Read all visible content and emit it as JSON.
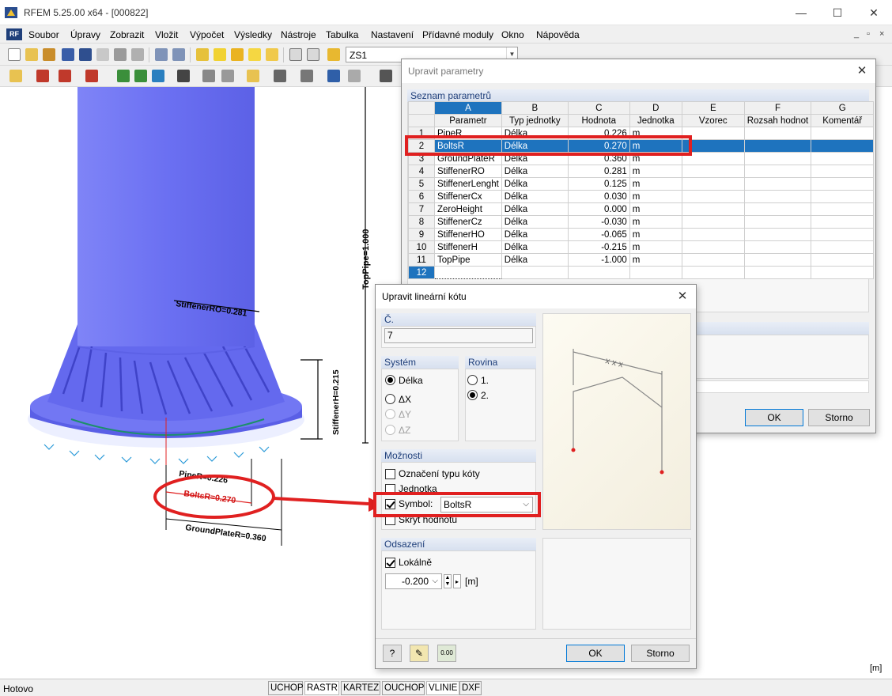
{
  "window": {
    "title": "RFEM 5.25.00 x64 - [000822]",
    "minimize": "—",
    "maximize": "☐",
    "close": "✕"
  },
  "menu": {
    "items": [
      "Soubor",
      "Úpravy",
      "Zobrazit",
      "Vložit",
      "Výpočet",
      "Výsledky",
      "Nástroje",
      "Tabulka",
      "Nastavení",
      "Přídavné moduly",
      "Okno",
      "Nápověda"
    ],
    "mdi_controls": [
      "_",
      "▫",
      "×"
    ]
  },
  "toolbar": {
    "load_case": "ZS1"
  },
  "model": {
    "labels": {
      "stiffener_ro": "StiffenerRO=0.281",
      "stiffener_h": "StiffenerH=0.215",
      "top_pipe": "TopPipe=1.000",
      "pipe_r": "PipeR=0.226",
      "bolts_r": "BoltsR=0.270",
      "ground_plate_r": "GroundPlateR=0.360"
    },
    "unit_marker": "[m]"
  },
  "params_dialog": {
    "title": "Upravit parametry",
    "section": "Seznam parametrů",
    "col_letters": [
      "A",
      "B",
      "C",
      "D",
      "E",
      "F",
      "G"
    ],
    "col_headers": [
      "Parametr",
      "Typ jednotky",
      "Hodnota",
      "Jednotka",
      "Vzorec",
      "Rozsah hodnot",
      "Komentář"
    ],
    "rows": [
      {
        "n": "1",
        "name": "PipeR",
        "type": "Délka",
        "value": "0.226",
        "unit": "m"
      },
      {
        "n": "2",
        "name": "BoltsR",
        "type": "Délka",
        "value": "0.270",
        "unit": "m"
      },
      {
        "n": "3",
        "name": "GroundPlateR",
        "type": "Délka",
        "value": "0.360",
        "unit": "m"
      },
      {
        "n": "4",
        "name": "StiffenerRO",
        "type": "Délka",
        "value": "0.281",
        "unit": "m"
      },
      {
        "n": "5",
        "name": "StiffenerLenght",
        "type": "Délka",
        "value": "0.125",
        "unit": "m"
      },
      {
        "n": "6",
        "name": "StiffenerCx",
        "type": "Délka",
        "value": "0.030",
        "unit": "m"
      },
      {
        "n": "7",
        "name": "ZeroHeight",
        "type": "Délka",
        "value": "0.000",
        "unit": "m"
      },
      {
        "n": "8",
        "name": "StiffenerCz",
        "type": "Délka",
        "value": "-0.030",
        "unit": "m"
      },
      {
        "n": "9",
        "name": "StiffenerHO",
        "type": "Délka",
        "value": "-0.065",
        "unit": "m"
      },
      {
        "n": "10",
        "name": "StiffenerH",
        "type": "Délka",
        "value": "-0.215",
        "unit": "m"
      },
      {
        "n": "11",
        "name": "TopPipe",
        "type": "Délka",
        "value": "-1.000",
        "unit": "m"
      },
      {
        "n": "12",
        "name": "",
        "type": "",
        "value": "",
        "unit": ""
      }
    ],
    "selected_row": 1,
    "ok": "OK",
    "cancel": "Storno"
  },
  "dim_dialog": {
    "title": "Upravit lineární kótu",
    "no_label": "Č.",
    "no_value": "7",
    "system": {
      "label": "Systém",
      "options": [
        "Délka",
        "ΔX",
        "ΔY",
        "ΔZ"
      ]
    },
    "plane": {
      "label": "Rovina",
      "options": [
        "1.",
        "2."
      ]
    },
    "options": {
      "label": "Možnosti",
      "type_label": "Označení typu kóty",
      "unit": "Jednotka",
      "symbol": "Symbol:",
      "symbol_value": "BoltsR",
      "hide_value": "Skrýt hodnotu"
    },
    "offset": {
      "label": "Odsazení",
      "local": "Lokálně",
      "value": "-0.200",
      "unit": "[m]"
    },
    "preview_label": "x x x",
    "ok": "OK",
    "cancel": "Storno",
    "num_btn": "0.00"
  },
  "status": {
    "text": "Hotovo",
    "buttons": [
      "UCHOP",
      "RASTR",
      "KARTEZ",
      "OUCHOP",
      "VLINIE",
      "DXF"
    ]
  },
  "colors": {
    "highlight": "#e02020",
    "selection": "#1e73be",
    "model": "#6a6ff5"
  }
}
